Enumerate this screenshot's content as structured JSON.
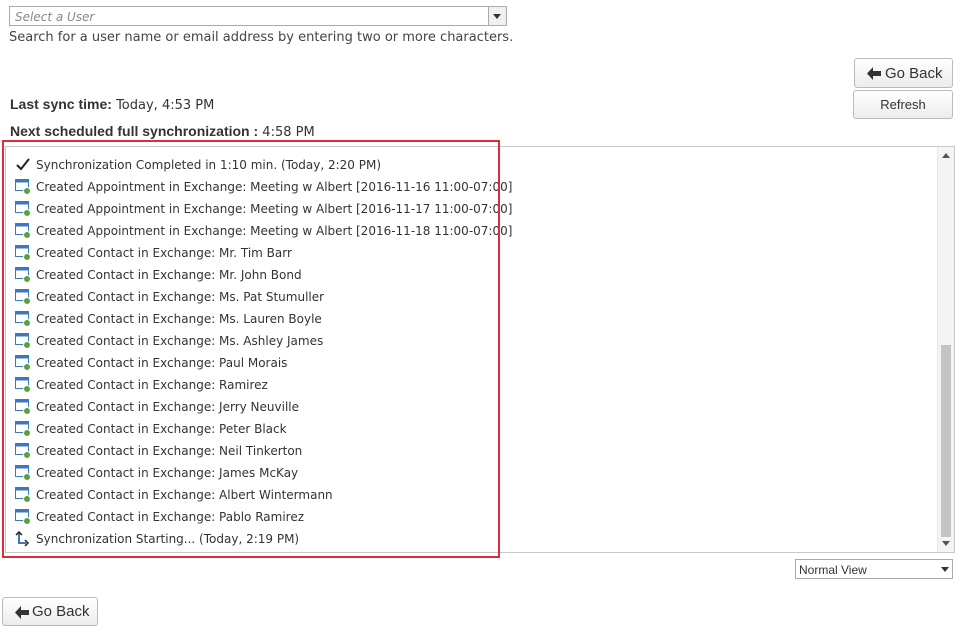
{
  "user_select": {
    "placeholder": "Select a User",
    "hint": "Search for a user name or email address by entering two or more characters."
  },
  "buttons": {
    "go_back": "Go Back",
    "refresh": "Refresh"
  },
  "sync": {
    "last_label": "Last sync time:",
    "last_value": "Today, 4:53 PM",
    "next_label": "Next scheduled full synchronization :",
    "next_value": "4:58 PM"
  },
  "log_entries": [
    {
      "icon": "check-icon",
      "text": "Synchronization Completed in 1:10 min. (Today, 2:20 PM)"
    },
    {
      "icon": "created-item-icon",
      "text": "Created Appointment in Exchange: Meeting w  Albert  [2016-11-16 11:00-07:00]"
    },
    {
      "icon": "created-item-icon",
      "text": "Created Appointment in Exchange: Meeting w  Albert  [2016-11-17 11:00-07:00]"
    },
    {
      "icon": "created-item-icon",
      "text": "Created Appointment in Exchange: Meeting w  Albert  [2016-11-18 11:00-07:00]"
    },
    {
      "icon": "created-item-icon",
      "text": "Created Contact in Exchange: Mr. Tim Barr"
    },
    {
      "icon": "created-item-icon",
      "text": "Created Contact in Exchange: Mr. John Bond"
    },
    {
      "icon": "created-item-icon",
      "text": "Created Contact in Exchange: Ms. Pat Stumuller"
    },
    {
      "icon": "created-item-icon",
      "text": "Created Contact in Exchange: Ms. Lauren Boyle"
    },
    {
      "icon": "created-item-icon",
      "text": "Created Contact in Exchange: Ms. Ashley James"
    },
    {
      "icon": "created-item-icon",
      "text": "Created Contact in Exchange: Paul Morais"
    },
    {
      "icon": "created-item-icon",
      "text": "Created Contact in Exchange: Ramirez"
    },
    {
      "icon": "created-item-icon",
      "text": "Created Contact in Exchange: Jerry Neuville"
    },
    {
      "icon": "created-item-icon",
      "text": "Created Contact in Exchange: Peter Black"
    },
    {
      "icon": "created-item-icon",
      "text": "Created Contact in Exchange: Neil Tinkerton"
    },
    {
      "icon": "created-item-icon",
      "text": "Created Contact in Exchange: James McKay"
    },
    {
      "icon": "created-item-icon",
      "text": "Created Contact in Exchange: Albert Wintermann"
    },
    {
      "icon": "created-item-icon",
      "text": "Created Contact in Exchange: Pablo Ramirez"
    },
    {
      "icon": "sync-start-icon",
      "text": "Synchronization Starting... (Today, 2:19 PM)"
    }
  ],
  "view_select": {
    "value": "Normal View"
  },
  "colors": {
    "highlight": "#dc2d3a",
    "icon_blue": "#3b78c2",
    "icon_green": "#5aa33a"
  }
}
